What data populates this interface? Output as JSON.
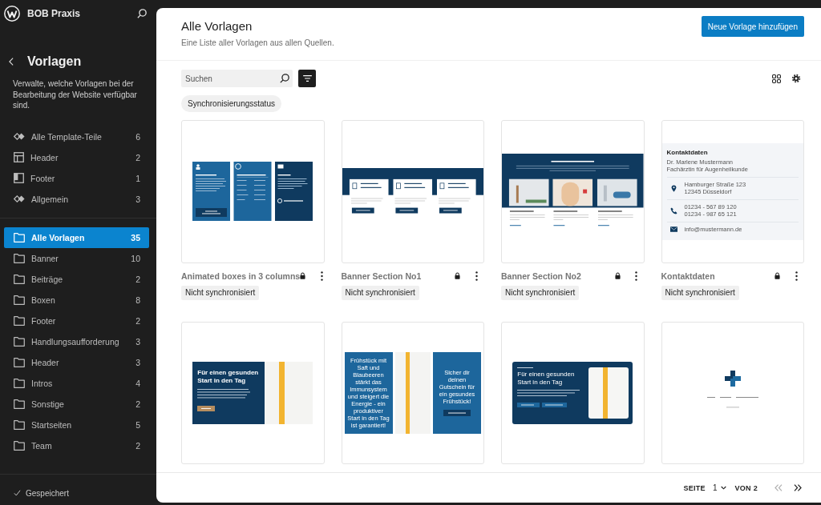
{
  "site": {
    "name": "BOB Praxis"
  },
  "sidebar": {
    "title": "Vorlagen",
    "description": "Verwalte, welche Vorlagen bei der Bearbeitung der Website verfügbar sind.",
    "template_parts": [
      {
        "kind": "all",
        "label": "Alle Template-Teile",
        "count": "6"
      },
      {
        "kind": "header",
        "label": "Header",
        "count": "2"
      },
      {
        "kind": "footer",
        "label": "Footer",
        "count": "1"
      },
      {
        "kind": "general",
        "label": "Allgemein",
        "count": "3"
      }
    ],
    "categories": [
      {
        "label": "Alle Vorlagen",
        "count": "35",
        "selected": true
      },
      {
        "label": "Banner",
        "count": "10",
        "selected": false
      },
      {
        "label": "Beiträge",
        "count": "2",
        "selected": false
      },
      {
        "label": "Boxen",
        "count": "8",
        "selected": false
      },
      {
        "label": "Footer",
        "count": "2",
        "selected": false
      },
      {
        "label": "Handlungsaufforderung",
        "count": "3",
        "selected": false
      },
      {
        "label": "Header",
        "count": "3",
        "selected": false
      },
      {
        "label": "Intros",
        "count": "4",
        "selected": false
      },
      {
        "label": "Sonstige",
        "count": "2",
        "selected": false
      },
      {
        "label": "Startseiten",
        "count": "5",
        "selected": false
      },
      {
        "label": "Team",
        "count": "2",
        "selected": false
      }
    ],
    "save_status": "Gespeichert"
  },
  "main": {
    "title": "Alle Vorlagen",
    "subtitle": "Eine Liste aller Vorlagen aus allen Quellen.",
    "add_button": "Neue Vorlage hinzufügen",
    "search": {
      "placeholder": "Suchen"
    },
    "filter_button": {
      "pressed": true
    },
    "filter_chip": "Synchronisierungsstatus",
    "patterns": [
      {
        "title": "Animated boxes in 3 columns",
        "locked": true,
        "badge": "Nicht synchronisiert",
        "preview": {
          "kind": "three-boxes"
        }
      },
      {
        "title": "Banner Section No1",
        "locked": true,
        "badge": "Nicht synchronisiert",
        "preview": {
          "kind": "banner-cards"
        }
      },
      {
        "title": "Banner Section No2",
        "locked": true,
        "badge": "Nicht synchronisiert",
        "preview": {
          "kind": "banner-photos"
        }
      },
      {
        "title": "Kontaktdaten",
        "locked": true,
        "badge": "Nicht synchronisiert",
        "preview": {
          "kind": "contact",
          "heading": "Kontaktdaten",
          "lines": [
            "Dr. Marlene Mustermann",
            "Fachärztin für Augenheilkunde"
          ],
          "entries": [
            {
              "kind": "address",
              "lines": [
                "Hamburger Straße 123",
                "12345 Düsseldorf"
              ]
            },
            {
              "kind": "phone",
              "lines": [
                "01234 - 567 89 120",
                "01234 - 987 65 121"
              ]
            },
            {
              "kind": "mail",
              "lines": [
                "info@mustermann.de"
              ]
            }
          ]
        }
      },
      {
        "preview": {
          "kind": "banner-split",
          "heading": "Für einen gesunden Start in den Tag"
        }
      },
      {
        "preview": {
          "kind": "banner-triple",
          "text": "Frühstück mit Saft und Blaubeeren stärkt das Immunsystem und steigert die Energie - ein produktiver Start in den Tag ist garantiert!",
          "offer": "Sicher dir deinen Gutschein für ein gesundes Frühstück!"
        }
      },
      {
        "preview": {
          "kind": "banner-card",
          "heading": "Für einen gesunden Start in den Tag"
        }
      },
      {
        "preview": {
          "kind": "footer-logo"
        }
      }
    ],
    "pagination": {
      "page_label": "SEITE",
      "page": "1",
      "total_label": "VON 2",
      "buttons": [
        {
          "kind": "previous",
          "disabled": true
        },
        {
          "kind": "next",
          "disabled": false
        }
      ]
    }
  }
}
